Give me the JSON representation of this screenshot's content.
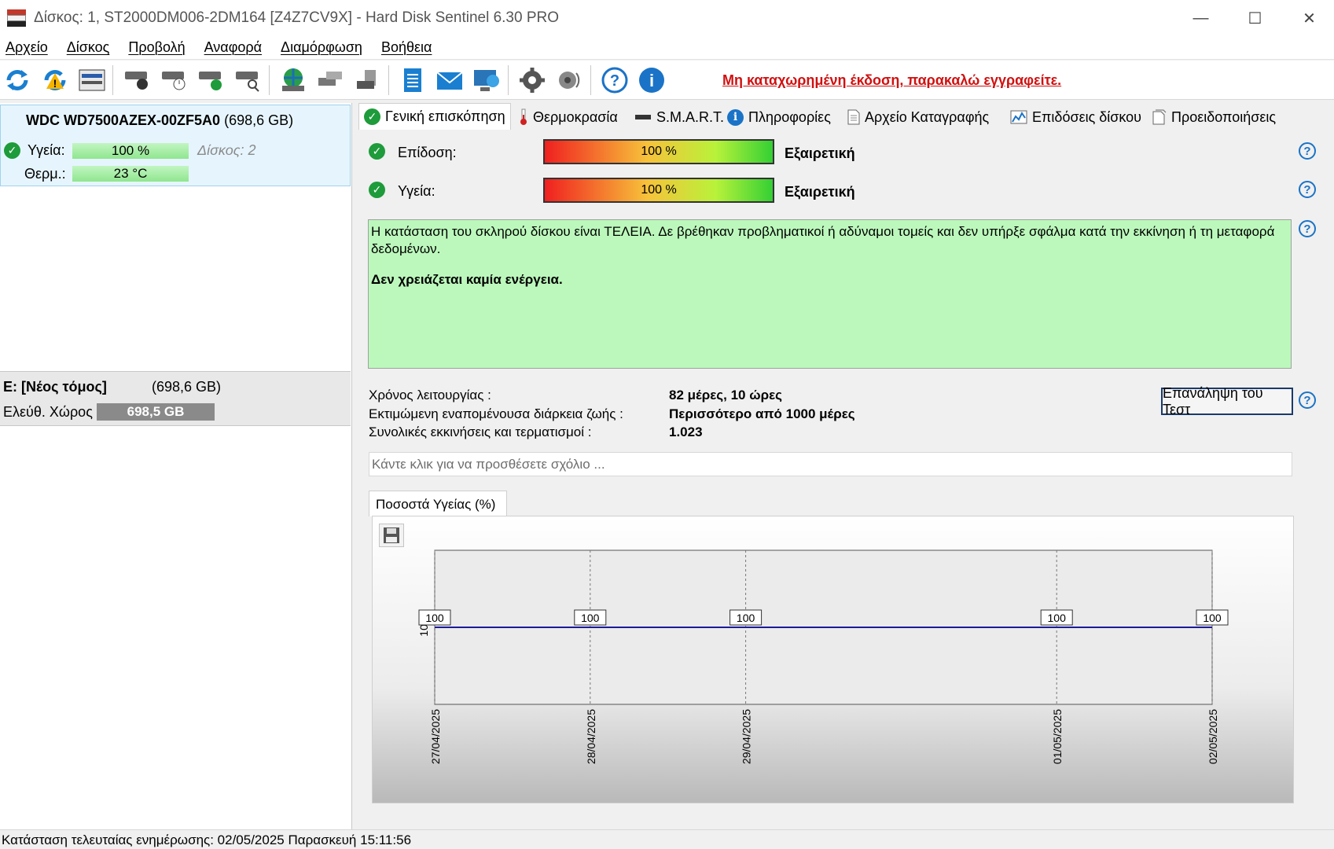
{
  "window": {
    "title": "Δίσκος: 1, ST2000DM006-2DM164 [Z4Z7CV9X]  -  Hard Disk Sentinel 6.30 PRO",
    "minimize": "—",
    "maximize": "☐",
    "close": "✕"
  },
  "menu": [
    "Αρχείο",
    "Δίσκος",
    "Προβολή",
    "Αναφορά",
    "Διαμόρφωση",
    "Βοήθεια"
  ],
  "toolbar": {
    "register_link": "Μη καταχωρημένη έκδοση, παρακαλώ εγγραφείτε."
  },
  "disk": {
    "model": "WDC WD7500AZEX-00ZF5A0",
    "capacity": "(698,6 GB)",
    "health_label": "Υγεία:",
    "health_value": "100 %",
    "disk_number": "Δίσκος: 2",
    "temp_label": "Θερμ.:",
    "temp_value": "23 °C"
  },
  "volume": {
    "name": "E: [Νέος τόμος]",
    "capacity": "(698,6 GB)",
    "free_label": "Ελεύθ. Χώρος",
    "free_value": "698,5 GB"
  },
  "tabs": [
    "Γενική επισκόπηση",
    "Θερμοκρασία",
    "S.M.A.R.T.",
    "Πληροφορίες",
    "Αρχείο Καταγραφής",
    "Επιδόσεις δίσκου",
    "Προειδοποιήσεις"
  ],
  "overview": {
    "performance_label": "Επίδοση:",
    "performance_value": "100 %",
    "performance_word": "Εξαιρετική",
    "health_label": "Υγεία:",
    "health_value": "100 %",
    "health_word": "Εξαιρετική",
    "status_text": "Η κατάσταση του σκληρού δίσκου είναι ΤΕΛΕΙΑ. Δε βρέθηκαν προβληματικοί ή αδύναμοι τομείς και δεν υπήρξε σφάλμα κατά την εκκίνηση ή τη μεταφορά δεδομένων.",
    "status_action": "Δεν χρειάζεται καμία ενέργεια.",
    "uptime_label": "Χρόνος λειτουργίας :",
    "uptime_value": "82 μέρες, 10 ώρες",
    "remaining_label": "Εκτιμώμενη εναπομένουσα διάρκεια ζωής :",
    "remaining_value": "Περισσότερο από 1000 μέρες",
    "starts_label": "Συνολικές εκκινήσεις και τερματισμοί :",
    "starts_value": "1.023",
    "retest_button": "Επανάληψη του Τεστ",
    "comment_placeholder": "Κάντε κλικ για να προσθέσετε σχόλιο ...",
    "chart_tab": "Ποσοστά Υγείας (%)"
  },
  "chart_data": {
    "type": "line",
    "title": "Ποσοστά Υγείας (%)",
    "x": [
      "27/04/2025",
      "28/04/2025",
      "29/04/2025",
      "01/05/2025",
      "02/05/2025"
    ],
    "values": [
      100,
      100,
      100,
      100,
      100
    ],
    "y_tick": "100",
    "grid": true,
    "line_color": "#1a1a9a"
  },
  "statusbar": {
    "text": "Κατάσταση τελευταίας ενημέρωσης: 02/05/2025 Παρασκευή 15:11:56"
  }
}
